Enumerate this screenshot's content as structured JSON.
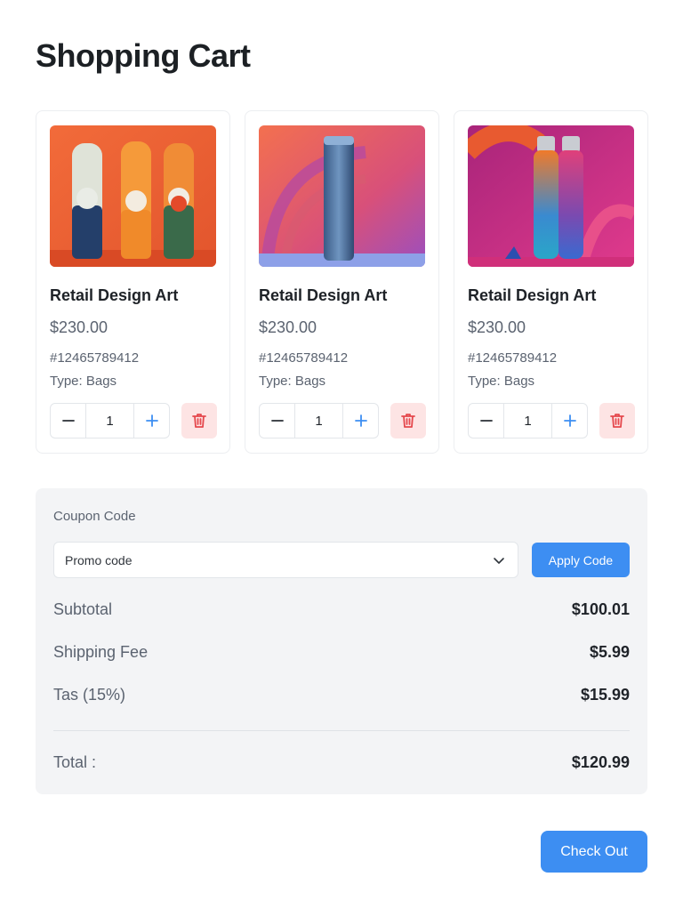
{
  "page": {
    "title": "Shopping Cart"
  },
  "colors": {
    "accent": "#3d8ef2",
    "danger": "#e5484d",
    "danger_bg": "#fde4e4"
  },
  "products": [
    {
      "name": "Retail Design Art",
      "price": "$230.00",
      "sku": "#12465789412",
      "type": "Type: Bags",
      "quantity": "1"
    },
    {
      "name": "Retail Design Art",
      "price": "$230.00",
      "sku": "#12465789412",
      "type": "Type: Bags",
      "quantity": "1"
    },
    {
      "name": "Retail Design Art",
      "price": "$230.00",
      "sku": "#12465789412",
      "type": "Type: Bags",
      "quantity": "1"
    }
  ],
  "icons": {
    "minus": "minus-icon",
    "plus": "plus-icon",
    "delete": "trash-icon",
    "dropdown": "chevron-down-icon"
  },
  "coupon": {
    "label": "Coupon Code",
    "selected": "Promo code",
    "apply_label": "Apply Code"
  },
  "summary": {
    "subtotal_label": "Subtotal",
    "subtotal_value": "$100.01",
    "shipping_label": "Shipping Fee",
    "shipping_value": "$5.99",
    "tax_label": "Tas (15%)",
    "tax_value": "$15.99",
    "total_label": "Total :",
    "total_value": "$120.99"
  },
  "checkout": {
    "label": "Check Out"
  }
}
